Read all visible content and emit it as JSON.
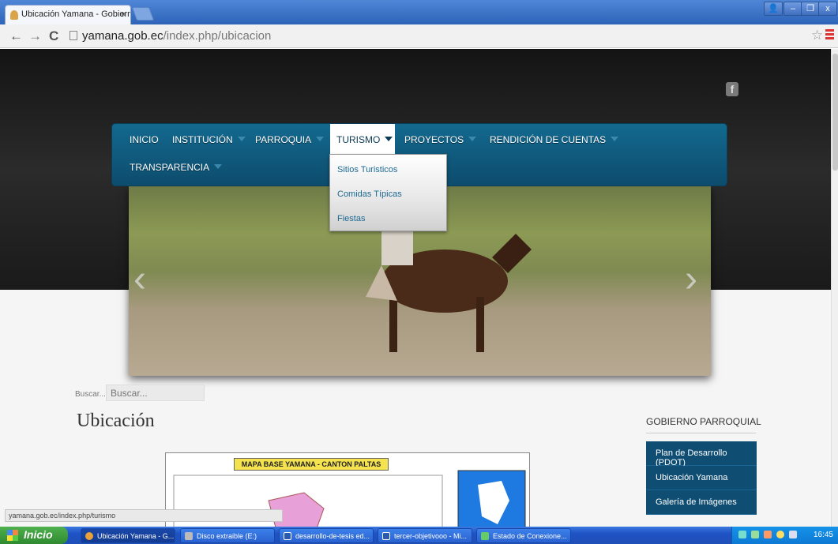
{
  "browser": {
    "tab_title": "Ubicación Yamana - Gobierno",
    "close_glyph": "×",
    "url_domain": "yamana.gob.ec",
    "url_path": "/index.php/ubicacion",
    "back_glyph": "←",
    "forward_glyph": "→",
    "reload_glyph": "C",
    "star_glyph": "☆",
    "status_url": "yamana.gob.ec/index.php/turismo"
  },
  "window_controls": {
    "user": "👤",
    "minimize": "–",
    "restore": "❐",
    "close": "x"
  },
  "site": {
    "facebook_glyph": "f",
    "nav": {
      "inicio": "INICIO",
      "institucion": "INSTITUCIÓN",
      "parroquia": "PARROQUIA",
      "turismo": "TURISMO",
      "proyectos": "PROYECTOS",
      "rendicion": "RENDICIÓN DE CUENTAS",
      "transparencia": "TRANSPARENCIA"
    },
    "dropdown": [
      "Sitios Turisticos",
      "Comidas Típicas",
      "Fiestas"
    ],
    "slider": {
      "prev_glyph": "‹",
      "next_glyph": "›"
    },
    "search": {
      "label": "Buscar...",
      "placeholder": "Buscar..."
    },
    "page_title": "Ubicación",
    "map_title": "MAPA BASE YAMANA - CANTON PALTAS",
    "sidebar": {
      "title": "GOBIERNO PARROQUIAL",
      "items": [
        "Plan de Desarrollo (PDOT)",
        "Ubicación Yamana",
        "Galería de Imágenes"
      ]
    }
  },
  "taskbar": {
    "start": "Inicio",
    "tasks": [
      "Ubicación Yamana - G...",
      "Disco extraible (E:)",
      "desarrollo-de-tesis ed...",
      "tercer-objetivooo - Mi...",
      "Estado de Conexione..."
    ],
    "clock": "16:45"
  },
  "colors": {
    "nav_blue": "#0f5a80",
    "sidebar_blue": "#0f4d73",
    "dropdown_link": "#1d6a92"
  }
}
